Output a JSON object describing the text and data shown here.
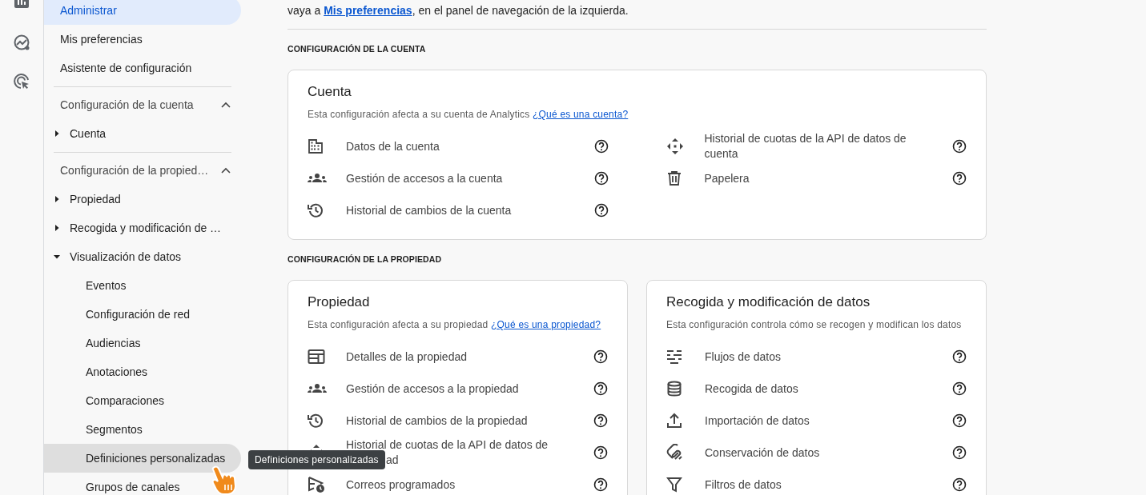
{
  "intro": {
    "text_before": "vaya a ",
    "link": "Mis preferencias",
    "text_after": ", en el panel de navegación de la izquierda."
  },
  "sidebar": {
    "items": [
      {
        "label": "Administrar",
        "selected": true
      },
      {
        "label": "Mis preferencias",
        "selected": false
      },
      {
        "label": "Asistente de configuración",
        "selected": false
      }
    ],
    "sections": [
      {
        "title": "Configuración de la cuenta",
        "expanded": true,
        "children": [
          {
            "label": "Cuenta",
            "expanded": false
          }
        ]
      },
      {
        "title": "Configuración de la propied…",
        "expanded": true,
        "children": [
          {
            "label": "Propiedad",
            "expanded": false
          },
          {
            "label": "Recogida y modificación de …",
            "expanded": false
          },
          {
            "label": "Visualización de datos",
            "expanded": true,
            "children": [
              {
                "label": "Eventos",
                "hovered": false
              },
              {
                "label": "Configuración de red",
                "hovered": false
              },
              {
                "label": "Audiencias",
                "hovered": false
              },
              {
                "label": "Anotaciones",
                "hovered": false
              },
              {
                "label": "Comparaciones",
                "hovered": false
              },
              {
                "label": "Segmentos",
                "hovered": false
              },
              {
                "label": "Definiciones personalizadas",
                "hovered": true
              },
              {
                "label": "Grupos de canales",
                "hovered": false
              }
            ]
          }
        ]
      }
    ]
  },
  "tooltip": {
    "text": "Definiciones personalizadas"
  },
  "sections": [
    {
      "heading": "CONFIGURACIÓN DE LA CUENTA",
      "cards": [
        {
          "title": "Cuenta",
          "description": "Esta configuración afecta a su cuenta de Analytics",
          "link": "¿Qué es una cuenta?",
          "columns": [
            [
              {
                "label": "Datos de la cuenta"
              },
              {
                "label": "Gestión de accesos a la cuenta"
              },
              {
                "label": "Historial de cambios de la cuenta"
              }
            ],
            [
              {
                "label": "Historial de cuotas de la API de datos de cuenta"
              },
              {
                "label": "Papelera"
              }
            ]
          ]
        }
      ]
    },
    {
      "heading": "CONFIGURACIÓN DE LA PROPIEDAD",
      "cards": [
        {
          "title": "Propiedad",
          "description": "Esta configuración afecta a su propiedad",
          "link": "¿Qué es una propiedad?",
          "columns": [
            [
              {
                "label": "Detalles de la propiedad"
              },
              {
                "label": "Gestión de accesos a la propiedad"
              },
              {
                "label": "Historial de cambios de la propiedad"
              },
              {
                "label": "Historial de cuotas de la API de datos de",
                "label_line_2": "ad"
              },
              {
                "label": "Correos programados"
              }
            ]
          ]
        },
        {
          "title": "Recogida y modificación de datos",
          "description": "Esta configuración controla cómo se recogen y modifican los datos",
          "columns": [
            [
              {
                "label": "Flujos de datos"
              },
              {
                "label": "Recogida de datos"
              },
              {
                "label": "Importación de datos"
              },
              {
                "label": "Conservación de datos"
              },
              {
                "label": "Filtros de datos"
              }
            ]
          ]
        }
      ]
    }
  ]
}
